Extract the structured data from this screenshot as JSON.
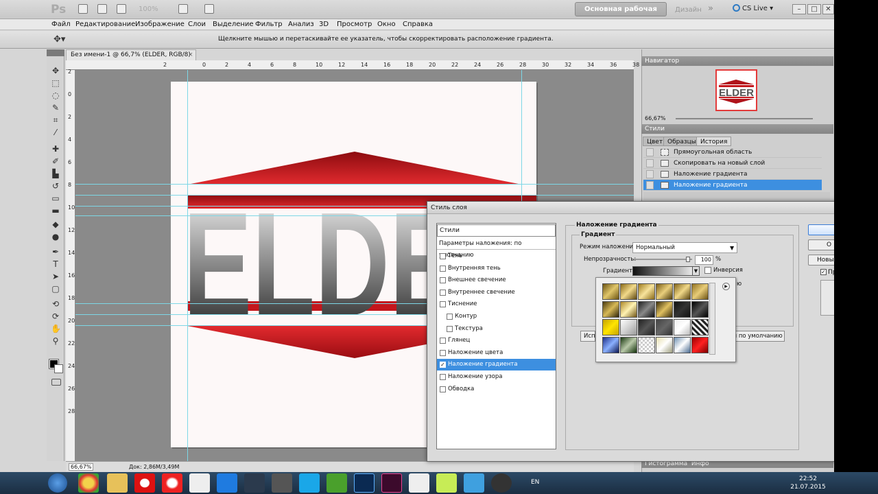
{
  "appbar": {
    "logo": "Ps",
    "zoom": "100%",
    "workspace": "Основная рабочая среда",
    "design": "Дизайн",
    "cslive": "CS Live",
    "win_min": "–",
    "win_max": "□",
    "win_close": "✕"
  },
  "menu": [
    "Файл",
    "Редактирование",
    "Изображение",
    "Слои",
    "Выделение",
    "Фильтр",
    "Анализ",
    "3D",
    "Просмотр",
    "Окно",
    "Справка"
  ],
  "options": {
    "hint": "Щелкните мышью и перетаскивайте ее указатель, чтобы скорректировать расположение градиента."
  },
  "document": {
    "tab": "Без имени-1 @ 66,7% (ELDER, RGB/8) *",
    "close": "×",
    "ruler_top": [
      "2",
      "0",
      "2",
      "4",
      "6",
      "8",
      "10",
      "12",
      "14",
      "16",
      "18",
      "20",
      "22",
      "24",
      "26",
      "28",
      "30",
      "32",
      "34",
      "36",
      "38",
      "40",
      "42",
      "44"
    ],
    "ruler_left": [
      "2",
      "0",
      "2",
      "4",
      "6",
      "8",
      "10",
      "12",
      "14",
      "16",
      "18",
      "20",
      "22",
      "24",
      "26",
      "28"
    ],
    "logo_text": "ELDER",
    "status_zoom": "66,67%",
    "status_doc": "Док: 2,86M/3,49M"
  },
  "panels": {
    "navigator": "Навигатор",
    "navigator_zoom": "66,67%",
    "nav_thumb_text": "ELDER",
    "styles": "Стили",
    "tabs": [
      "Цвет",
      "Образцы",
      "История"
    ],
    "history": [
      "Прямоугольная область",
      "Скопировать на новый слой",
      "Наложение градиента",
      "Наложение градиента"
    ],
    "bottom_tabs": [
      "Гистограмма",
      "Инфо"
    ]
  },
  "dialog": {
    "title": "Стиль слоя",
    "styles_header": "Стили",
    "params": "Параметры наложения: по умолчанию",
    "items": [
      {
        "label": "Тень",
        "checked": false,
        "sub": false
      },
      {
        "label": "Внутренняя тень",
        "checked": false,
        "sub": false
      },
      {
        "label": "Внешнее свечение",
        "checked": false,
        "sub": false
      },
      {
        "label": "Внутреннее свечение",
        "checked": false,
        "sub": false
      },
      {
        "label": "Тиснение",
        "checked": false,
        "sub": false
      },
      {
        "label": "Контур",
        "checked": false,
        "sub": true
      },
      {
        "label": "Текстура",
        "checked": false,
        "sub": true
      },
      {
        "label": "Глянец",
        "checked": false,
        "sub": false
      },
      {
        "label": "Наложение цвета",
        "checked": false,
        "sub": false
      },
      {
        "label": "Наложение градиента",
        "checked": true,
        "sub": false
      },
      {
        "label": "Наложение узора",
        "checked": false,
        "sub": false
      },
      {
        "label": "Обводка",
        "checked": false,
        "sub": false
      }
    ],
    "section_title": "Наложение градиента",
    "subsection": "Градиент",
    "blend_label": "Режим наложения:",
    "blend_value": "Нормальный",
    "opacity_label": "Непрозрачность:",
    "opacity_value": "100",
    "opacity_unit": "%",
    "opacity_level": 0.95,
    "gradient_label": "Градиент:",
    "invert_label": "Инверсия",
    "hidden_fragment": "ю",
    "btn_left": "Исп",
    "btn_default": "я по умолчанию",
    "btn_cancel": "О",
    "btn_new": "Новы",
    "preview_label": "Пр",
    "checkmark": "✓"
  },
  "taskbar": {
    "lang": "EN",
    "time": "22:52",
    "date": "21.07.2015"
  },
  "colors": {
    "accent_blue": "#3d8fe0",
    "logo_red": "#c4161c",
    "guide": "#7dd7e6"
  }
}
